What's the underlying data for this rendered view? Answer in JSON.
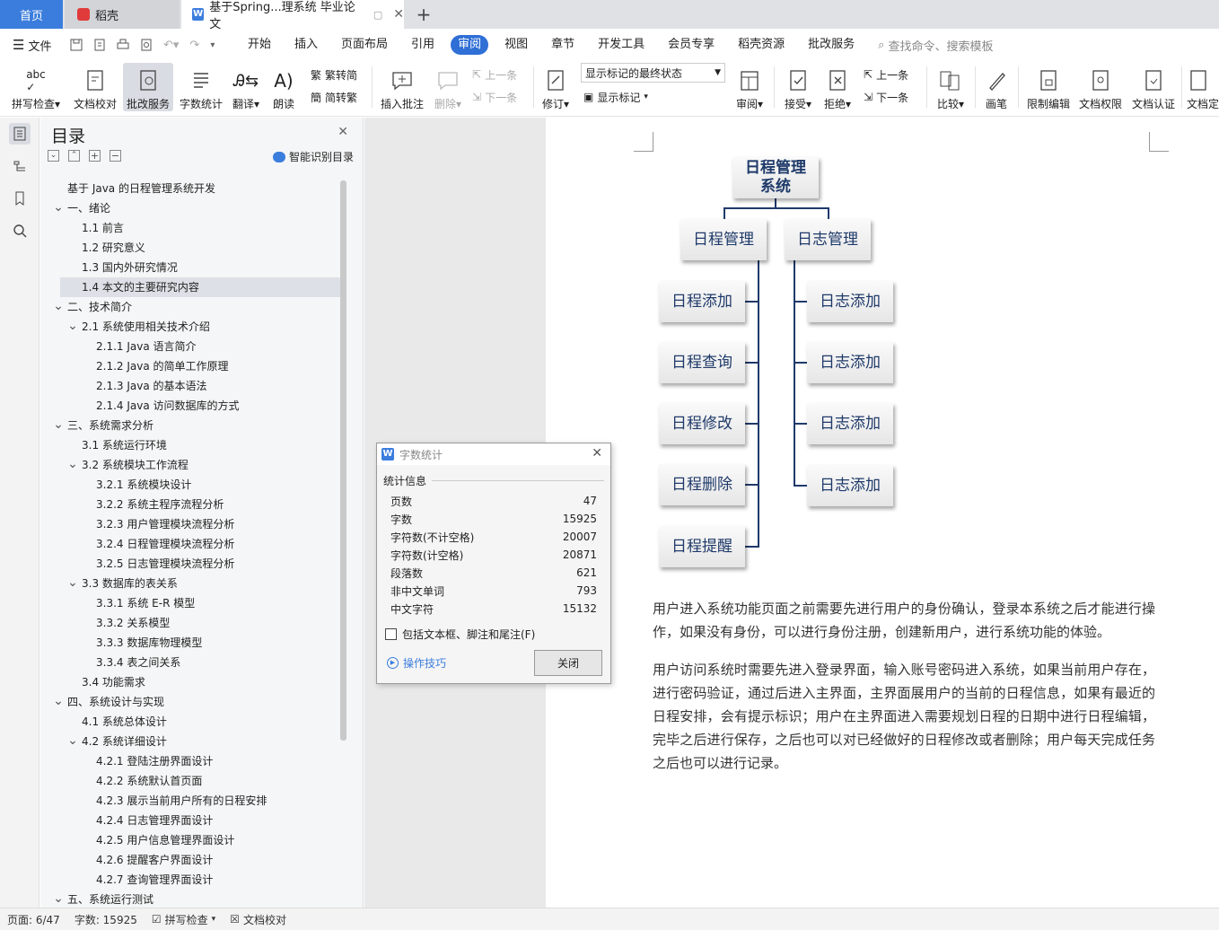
{
  "tabs": {
    "home": "首页",
    "daoke": "稻壳",
    "doc": "基于Spring...理系统 毕业论文",
    "new_tab": "+"
  },
  "menu": {
    "file": "文件",
    "items": [
      "开始",
      "插入",
      "页面布局",
      "引用",
      "审阅",
      "视图",
      "章节",
      "开发工具",
      "会员专享",
      "稻壳资源",
      "批改服务"
    ],
    "active": "审阅",
    "search": "查找命令、搜索模板"
  },
  "ribbon": {
    "spell": "拼写检查",
    "proof": "文档校对",
    "correct": "批改服务",
    "wordcount": "字数统计",
    "translate": "翻译",
    "read": "朗读",
    "trad": "繁转简",
    "simp": "简转繁",
    "add_comment": "插入批注",
    "delete": "删除",
    "prev": "上一条",
    "next": "下一条",
    "track": "修订",
    "markup_state": "显示标记的最终状态",
    "show_markup": "显示标记",
    "review": "审阅",
    "accept": "接受",
    "reject": "拒绝",
    "prev2": "上一条",
    "next2": "下一条",
    "compare": "比较",
    "pen": "画笔",
    "restrict": "限制编辑",
    "rights": "文档权限",
    "cert": "文档认证",
    "finalize": "文档定"
  },
  "toc": {
    "title": "目录",
    "smart": "智能识别目录",
    "items": [
      {
        "text": "基于 Java 的日程管理系统开发",
        "level": 0,
        "chev": ""
      },
      {
        "text": "一、绪论",
        "level": 0,
        "chev": "v"
      },
      {
        "text": "1.1  前言",
        "level": 1,
        "chev": ""
      },
      {
        "text": "1.2  研究意义",
        "level": 1,
        "chev": ""
      },
      {
        "text": "1.3  国内外研究情况",
        "level": 1,
        "chev": ""
      },
      {
        "text": "1.4  本文的主要研究内容",
        "level": 1,
        "chev": "",
        "selected": true
      },
      {
        "text": "二、技术简介",
        "level": 0,
        "chev": "v"
      },
      {
        "text": "2.1  系统使用相关技术介绍",
        "level": 1,
        "chev": "v"
      },
      {
        "text": "2.1.1 Java 语言简介",
        "level": 2,
        "chev": ""
      },
      {
        "text": "2.1.2 Java 的简单工作原理",
        "level": 2,
        "chev": ""
      },
      {
        "text": "2.1.3 Java 的基本语法",
        "level": 2,
        "chev": ""
      },
      {
        "text": "2.1.4 Java 访问数据库的方式",
        "level": 2,
        "chev": ""
      },
      {
        "text": "三、系统需求分析",
        "level": 0,
        "chev": "v"
      },
      {
        "text": "3.1  系统运行环境",
        "level": 1,
        "chev": ""
      },
      {
        "text": "3.2  系统模块工作流程",
        "level": 1,
        "chev": "v"
      },
      {
        "text": "3.2.1  系统模块设计",
        "level": 2,
        "chev": ""
      },
      {
        "text": "3.2.2  系统主程序流程分析",
        "level": 2,
        "chev": ""
      },
      {
        "text": "3.2.3  用户管理模块流程分析",
        "level": 2,
        "chev": ""
      },
      {
        "text": "3.2.4  日程管理模块流程分析",
        "level": 2,
        "chev": ""
      },
      {
        "text": "3.2.5  日志管理模块流程分析",
        "level": 2,
        "chev": ""
      },
      {
        "text": "3.3  数据库的表关系",
        "level": 1,
        "chev": "v"
      },
      {
        "text": "3.3.1  系统 E-R 模型",
        "level": 2,
        "chev": ""
      },
      {
        "text": "3.3.2  关系模型",
        "level": 2,
        "chev": ""
      },
      {
        "text": "3.3.3  数据库物理模型",
        "level": 2,
        "chev": ""
      },
      {
        "text": "3.3.4  表之间关系",
        "level": 2,
        "chev": ""
      },
      {
        "text": "3.4  功能需求",
        "level": 1,
        "chev": ""
      },
      {
        "text": "四、系统设计与实现",
        "level": 0,
        "chev": "v"
      },
      {
        "text": "4.1  系统总体设计",
        "level": 1,
        "chev": ""
      },
      {
        "text": "4.2  系统详细设计",
        "level": 1,
        "chev": "v"
      },
      {
        "text": "4.2.1  登陆注册界面设计",
        "level": 2,
        "chev": ""
      },
      {
        "text": "4.2.2  系统默认首页面",
        "level": 2,
        "chev": ""
      },
      {
        "text": "4.2.3  展示当前用户所有的日程安排",
        "level": 2,
        "chev": ""
      },
      {
        "text": "4.2.4  日志管理界面设计",
        "level": 2,
        "chev": ""
      },
      {
        "text": "4.2.5  用户信息管理界面设计",
        "level": 2,
        "chev": ""
      },
      {
        "text": "4.2.6  提醒客户界面设计",
        "level": 2,
        "chev": ""
      },
      {
        "text": "4.2.7  查询管理界面设计",
        "level": 2,
        "chev": ""
      },
      {
        "text": "五、系统运行测试",
        "level": 0,
        "chev": "v"
      }
    ]
  },
  "diagram": {
    "root": "日程管理\n系统",
    "left_branch": "日程管理",
    "right_branch": "日志管理",
    "left_children": [
      "日程添加",
      "日程查询",
      "日程修改",
      "日程删除",
      "日程提醒"
    ],
    "right_children": [
      "日志添加",
      "日志添加",
      "日志添加",
      "日志添加"
    ]
  },
  "doc": {
    "para1": "用户进入系统功能页面之前需要先进行用户的身份确认，登录本系统之后才能进行操作，如果没有身份，可以进行身份注册，创建新用户，进行系统功能的体验。",
    "para2": "用户访问系统时需要先进入登录界面，输入账号密码进入系统，如果当前用户存在，进行密码验证，通过后进入主界面，主界面展用户的当前的日程信息，如果有最近的日程安排，会有提示标识；用户在主界面进入需要规划日程的日期中进行日程编辑，完毕之后进行保存，之后也可以对已经做好的日程修改或者删除；用户每天完成任务之后也可以进行记录。"
  },
  "dialog": {
    "title": "字数统计",
    "section": "统计信息",
    "rows": [
      {
        "label": "页数",
        "value": "47"
      },
      {
        "label": "字数",
        "value": "15925"
      },
      {
        "label": "字符数(不计空格)",
        "value": "20007"
      },
      {
        "label": "字符数(计空格)",
        "value": "20871"
      },
      {
        "label": "段落数",
        "value": "621"
      },
      {
        "label": "非中文单词",
        "value": "793"
      },
      {
        "label": "中文字符",
        "value": "15132"
      }
    ],
    "checkbox": "包括文本框、脚注和尾注(F)",
    "tips": "操作技巧",
    "close": "关闭"
  },
  "status": {
    "page": "页面: 6/47",
    "words": "字数: 15925",
    "spell": "拼写检查",
    "proof": "文档校对"
  }
}
